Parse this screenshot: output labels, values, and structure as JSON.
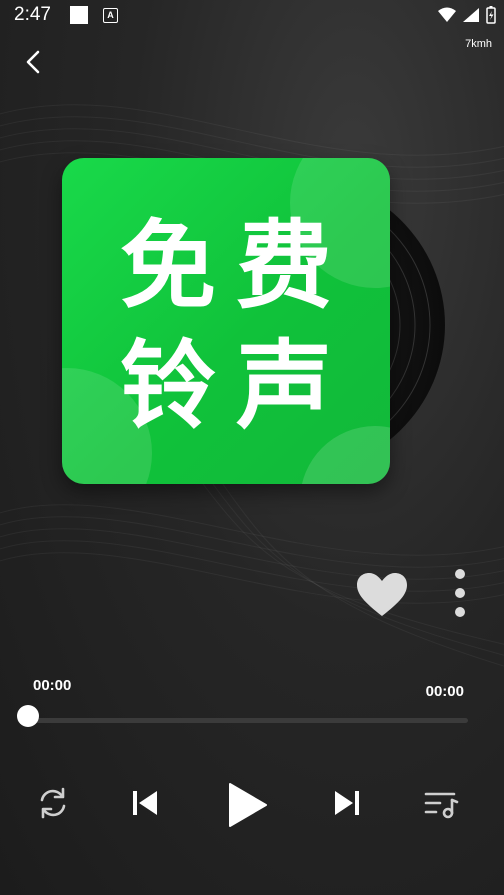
{
  "status_bar": {
    "time": "2:47",
    "notification_icon": "a-badge-icon",
    "net_speed": "7kmh"
  },
  "navigation": {
    "back_icon": "back-arrow-icon"
  },
  "album": {
    "cover_text_line1_char1": "免",
    "cover_text_line1_char2": "费",
    "cover_text_line2_char1": "铃",
    "cover_text_line2_char2": "声",
    "cover_color": "#16cc3f"
  },
  "actions": {
    "favorite_icon": "heart-icon",
    "more_icon": "more-vertical-icon"
  },
  "player": {
    "current_time": "00:00",
    "total_time": "00:00",
    "progress": 0
  },
  "controls": {
    "loop_icon": "repeat-icon",
    "prev_icon": "skip-previous-icon",
    "play_icon": "play-icon",
    "next_icon": "skip-next-icon",
    "playlist_icon": "playlist-music-icon"
  },
  "colors": {
    "accent": "#16cc3f",
    "background": "#232323",
    "icon": "#d6d6d6"
  }
}
